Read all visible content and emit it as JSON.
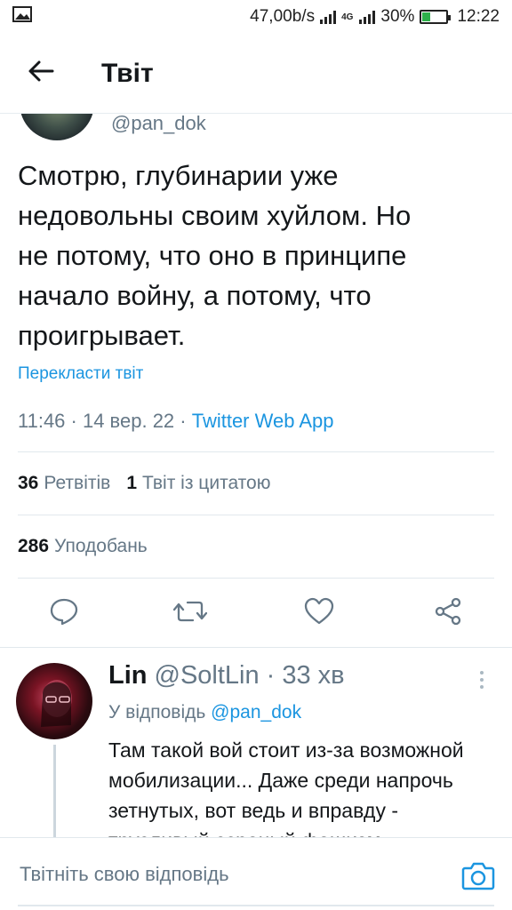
{
  "status_bar": {
    "speed": "47,00b/s",
    "network": "4G",
    "battery": "30%",
    "battery_level": 0.3,
    "time": "12:22"
  },
  "header": {
    "title": "Твіт"
  },
  "tweet": {
    "handle": "@pan_dok",
    "lines": [
      "Смотрю, глубинарии уже",
      "недовольны своим хуйлом. Но",
      "не потому, что оно в принципе",
      "начало войну, а потому, что",
      "проигрывает."
    ],
    "translate_label": "Перекласти твіт",
    "timestamp": "11:46 · 14 вер. 22 · ",
    "source": "Twitter Web App",
    "retweets_count": "36",
    "retweets_label": "Ретвітів",
    "quotes_count": "1",
    "quotes_label": "Твіт із цитатою",
    "likes_count": "286",
    "likes_label": "Уподобань"
  },
  "actions": {
    "icons": [
      "reply-icon",
      "retweet-icon",
      "like-icon",
      "share-icon"
    ]
  },
  "reply": {
    "name": "Lin",
    "handle": "@SoltLin",
    "time": "· 33 хв",
    "reply_to_label": "У відповідь",
    "reply_to_handle": "@pan_dok",
    "lines": [
      "Там такой вой стоит из-за возможной",
      "мобилизации... Даже среди напрочь",
      "зетнутых, вот ведь и вправду -",
      "трусливый ссраный фашизм."
    ]
  },
  "compose": {
    "placeholder": "Твітніть свою відповідь"
  },
  "colors": {
    "accent": "#1b95e0",
    "muted": "#657786",
    "text": "#14171a",
    "divider": "#e1e8ed"
  }
}
